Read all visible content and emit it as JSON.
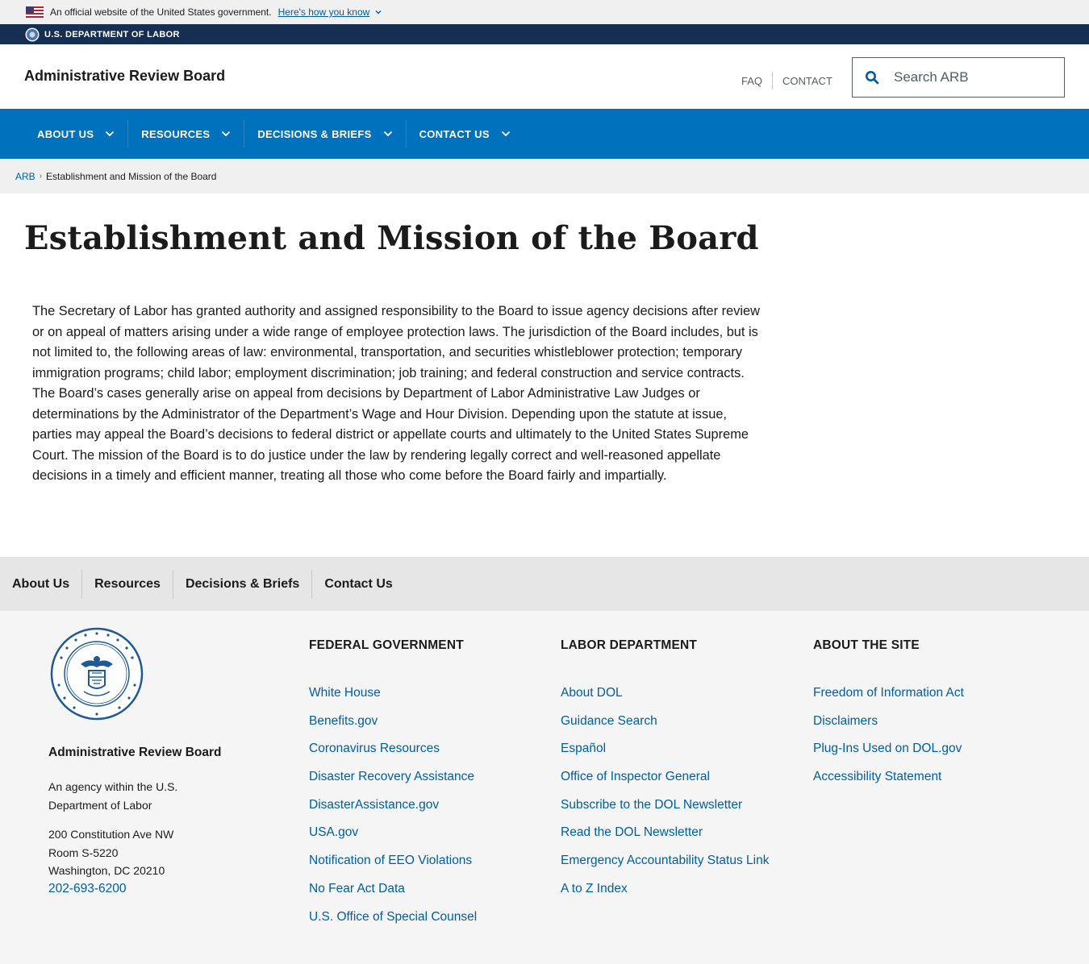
{
  "gov_banner": {
    "text": "An official website of the United States government.",
    "how_link": "Here's how you know"
  },
  "dol_strip": {
    "label": "U.S. DEPARTMENT OF LABOR"
  },
  "header": {
    "site_title": "Administrative Review Board",
    "util_links": [
      "FAQ",
      "CONTACT"
    ],
    "search_placeholder": "Search ARB"
  },
  "nav": {
    "items": [
      "ABOUT US",
      "RESOURCES",
      "DECISIONS & BRIEFS",
      "CONTACT US"
    ]
  },
  "breadcrumb": {
    "home": "ARB",
    "current": "Establishment and Mission of the Board"
  },
  "main": {
    "title": "Establishment and Mission of the Board",
    "body": "The Secretary of Labor has granted authority and assigned responsibility to the Board to issue agency decisions after review or on appeal of matters arising under a wide range of employee protection laws. The jurisdiction of the Board includes, but is not limited to, the following areas of law: environmental, transportation, and securities whistleblower protection; temporary immigration programs; child labor; employment discrimination; job training; and federal construction and service contracts. The Board’s cases generally arise on appeal from decisions by Department of Labor Administrative Law Judges or determinations by the Administrator of the Department’s Wage and Hour Division. Depending upon the statute at issue, parties may appeal the Board’s decisions to federal district or appellate courts and ultimately to the United States Supreme Court. The mission of the Board is to do justice under the law by rendering legally correct and well-reasoned appellate decisions in a timely and efficient manner, treating all those who come before the Board fairly and impartially."
  },
  "footer_nav": {
    "items": [
      "About Us",
      "Resources",
      "Decisions & Briefs",
      "Contact Us"
    ]
  },
  "footer": {
    "agency_name": "Administrative Review Board",
    "agency_desc": "An agency within the U.S. Department of Labor",
    "address": [
      "200 Constitution Ave NW",
      "Room S-5220",
      "Washington, DC 20210"
    ],
    "phone": "202-693-6200",
    "columns": [
      {
        "heading": "FEDERAL GOVERNMENT",
        "links": [
          "White House",
          "Benefits.gov",
          "Coronavirus Resources",
          "Disaster Recovery Assistance",
          "DisasterAssistance.gov",
          "USA.gov",
          "Notification of EEO Violations",
          "No Fear Act Data",
          "U.S. Office of Special Counsel"
        ]
      },
      {
        "heading": "LABOR DEPARTMENT",
        "links": [
          "About DOL",
          "Guidance Search",
          "Español",
          "Office of Inspector General",
          "Subscribe to the DOL Newsletter",
          "Read the DOL Newsletter",
          "Emergency Accountability Status Link",
          "A to Z Index"
        ]
      },
      {
        "heading": "ABOUT THE SITE",
        "links": [
          "Freedom of Information Act",
          "Disclaimers",
          "Plug-Ins Used on DOL.gov",
          "Accessibility Statement"
        ]
      }
    ]
  },
  "colors": {
    "nav_blue": "#0071bc",
    "dark_navy": "#162e51",
    "link_blue": "#005ea2"
  }
}
